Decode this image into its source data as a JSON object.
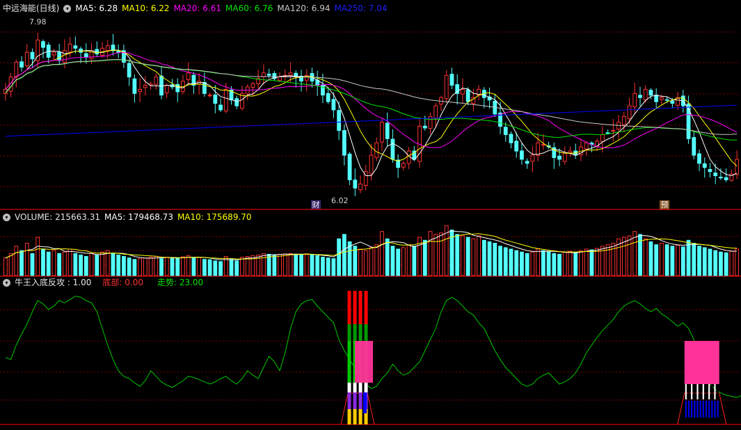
{
  "header_main": {
    "title": "中远海能(日线)",
    "ma5": "MA5: 6.28",
    "ma10": "MA10: 6.22",
    "ma20": "MA20: 6.61",
    "ma60": "MA60: 6.76",
    "ma120": "MA120: 6.94",
    "ma250": "MA250: 7.04"
  },
  "header_volume": {
    "volume": "VOLUME: 215663.31",
    "ma5": "MA5: 179468.73",
    "ma10": "MA10: 175689.70"
  },
  "header_indicator": {
    "name": "牛王入底反攻 : 1.00",
    "bottom": "底部: 0.00",
    "trend": "走势: 23.00"
  },
  "annotations": {
    "high_label": "7.98",
    "low_label": "6.02",
    "marker_cai": "财",
    "marker_yu": "预"
  },
  "colors": {
    "up": "#ff3232",
    "down": "#54ffff",
    "ma5": "#ffffff",
    "ma10": "#ffff00",
    "ma20": "#ff00ff",
    "ma60": "#00e600",
    "ma120": "#c8c8c8",
    "ma250": "#0000ff",
    "trend": "#00c800",
    "pink": "#ff3399",
    "grid": "#800000"
  },
  "chart_data": [
    {
      "type": "candlestick",
      "title": "中远海能(日线)",
      "ylim": [
        5.9,
        8.15
      ],
      "close": [
        7.25,
        7.4,
        7.58,
        7.52,
        7.7,
        7.62,
        7.85,
        7.76,
        7.64,
        7.7,
        7.6,
        7.72,
        7.8,
        7.75,
        7.7,
        7.64,
        7.72,
        7.68,
        7.75,
        7.78,
        7.72,
        7.7,
        7.58,
        7.4,
        7.2,
        7.25,
        7.3,
        7.32,
        7.4,
        7.18,
        7.3,
        7.28,
        7.22,
        7.35,
        7.45,
        7.3,
        7.35,
        7.2,
        7.18,
        7.08,
        7.0,
        7.25,
        7.12,
        7.05,
        7.2,
        7.28,
        7.32,
        7.38,
        7.45,
        7.42,
        7.38,
        7.4,
        7.42,
        7.45,
        7.4,
        7.35,
        7.42,
        7.35,
        7.3,
        7.18,
        7.1,
        7.0,
        6.75,
        6.45,
        6.15,
        6.05,
        6.1,
        6.25,
        6.45,
        6.6,
        6.85,
        6.65,
        6.4,
        6.3,
        6.35,
        6.5,
        6.4,
        6.8,
        6.78,
        6.92,
        7.05,
        7.15,
        7.42,
        7.3,
        7.2,
        7.25,
        7.1,
        7.15,
        7.25,
        7.15,
        7.12,
        6.95,
        6.8,
        6.7,
        6.6,
        6.5,
        6.4,
        6.35,
        6.45,
        6.6,
        6.58,
        6.55,
        6.42,
        6.4,
        6.48,
        6.5,
        6.45,
        6.55,
        6.6,
        6.58,
        6.62,
        6.7,
        6.72,
        6.75,
        6.85,
        6.92,
        7.05,
        7.2,
        7.15,
        7.25,
        7.18,
        7.1,
        7.15,
        7.12,
        7.08,
        7.15,
        7.05,
        6.65,
        6.45,
        6.35,
        6.3,
        6.25,
        6.2,
        6.18,
        6.15,
        6.22,
        6.4
      ],
      "volume": [
        120000,
        150000,
        200000,
        170000,
        220000,
        150000,
        260000,
        180000,
        160000,
        170000,
        150000,
        160000,
        180000,
        150000,
        140000,
        130000,
        150000,
        140000,
        160000,
        170000,
        150000,
        140000,
        130000,
        120000,
        110000,
        115000,
        120000,
        125000,
        130000,
        115000,
        125000,
        120000,
        118000,
        128000,
        135000,
        120000,
        125000,
        110000,
        108000,
        100000,
        95000,
        130000,
        110000,
        100000,
        125000,
        130000,
        135000,
        140000,
        150000,
        145000,
        140000,
        145000,
        148000,
        150000,
        145000,
        140000,
        148000,
        140000,
        135000,
        125000,
        120000,
        115000,
        250000,
        280000,
        230000,
        200000,
        180000,
        170000,
        190000,
        210000,
        300000,
        250000,
        200000,
        180000,
        190000,
        210000,
        200000,
        260000,
        240000,
        300000,
        280000,
        290000,
        340000,
        310000,
        280000,
        270000,
        260000,
        250000,
        270000,
        240000,
        230000,
        220000,
        200000,
        190000,
        180000,
        170000,
        160000,
        150000,
        160000,
        180000,
        170000,
        165000,
        150000,
        145000,
        160000,
        165000,
        155000,
        170000,
        180000,
        175000,
        185000,
        200000,
        210000,
        220000,
        250000,
        260000,
        270000,
        300000,
        280000,
        250000,
        230000,
        210000,
        220000,
        210000,
        200000,
        205000,
        195000,
        240000,
        220000,
        200000,
        190000,
        180000,
        170000,
        160000,
        155000,
        165000,
        180000
      ]
    },
    {
      "type": "line",
      "series": [
        {
          "name": "走势",
          "values": [
            44,
            42,
            55,
            65,
            74,
            85,
            95,
            92,
            87,
            90,
            95,
            93,
            96,
            99,
            98,
            95,
            93,
            85,
            70,
            55,
            42,
            32,
            27,
            25,
            21,
            18,
            23,
            32,
            27,
            22,
            19,
            17,
            20,
            23,
            27,
            26,
            24,
            22,
            20,
            22,
            25,
            27,
            23,
            20,
            25,
            32,
            28,
            25,
            35,
            45,
            40,
            32,
            48,
            70,
            85,
            92,
            95,
            96,
            90,
            85,
            80,
            75,
            60,
            50,
            42,
            34,
            26,
            20,
            16,
            18,
            25,
            30,
            38,
            32,
            28,
            30,
            35,
            40,
            50,
            60,
            70,
            85,
            95,
            98,
            95,
            90,
            85,
            82,
            75,
            70,
            60,
            50,
            42,
            35,
            30,
            25,
            20,
            18,
            20,
            25,
            28,
            30,
            25,
            20,
            22,
            25,
            30,
            38,
            48,
            55,
            62,
            68,
            73,
            78,
            85,
            90,
            93,
            95,
            92,
            88,
            85,
            88,
            83,
            80,
            76,
            72,
            75,
            70,
            60,
            40,
            28,
            20,
            15,
            12,
            10,
            9,
            8,
            10,
            16
          ]
        }
      ],
      "markers": [
        {
          "label": "牛王入底反攻",
          "value": 1.0
        },
        {
          "label": "底部",
          "value": 0.0
        },
        {
          "label": "走势",
          "value": 23.0
        }
      ]
    }
  ]
}
